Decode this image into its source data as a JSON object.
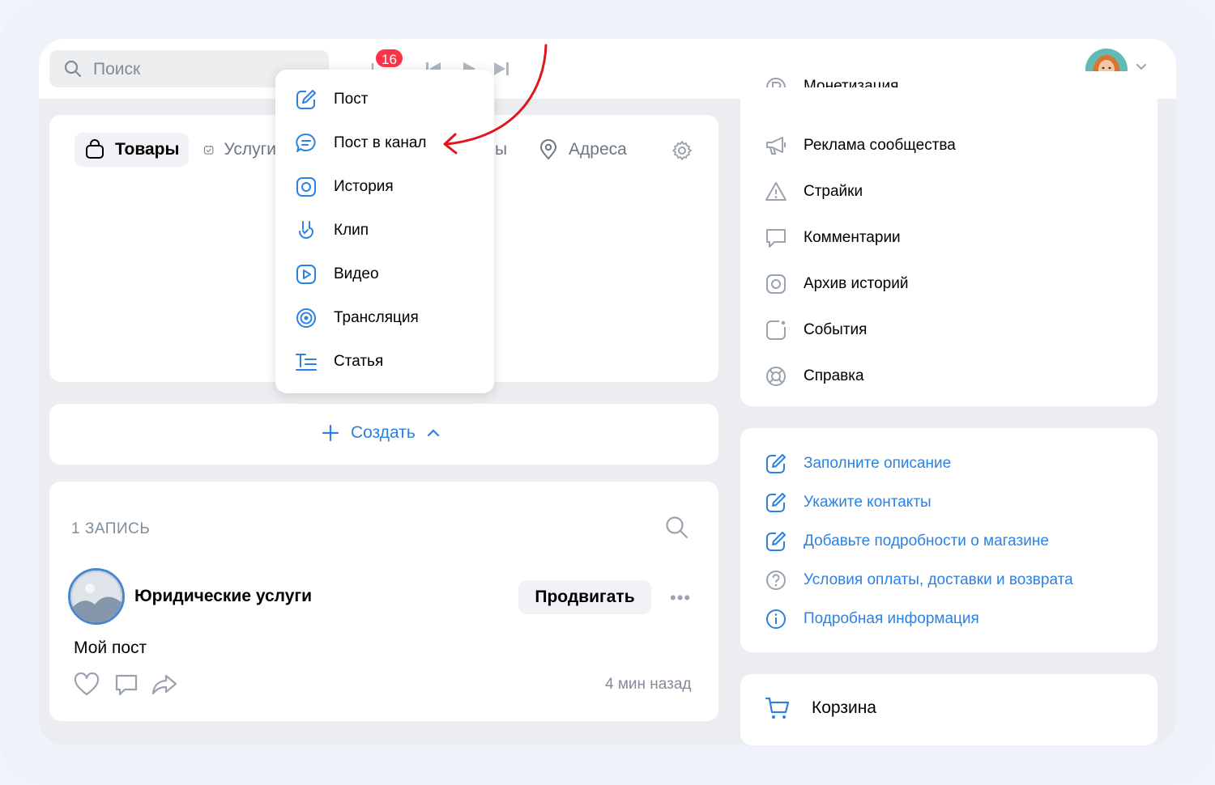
{
  "search": {
    "placeholder": "Поиск"
  },
  "notifications": {
    "badge": "16"
  },
  "tabs": {
    "items": [
      {
        "label": "Товары"
      },
      {
        "label": "Услуги"
      },
      {
        "label": "ы"
      },
      {
        "label": "Адреса"
      }
    ]
  },
  "create": {
    "label": "Создать"
  },
  "dropdown": {
    "items": [
      {
        "label": "Пост",
        "icon": "edit-icon"
      },
      {
        "label": "Пост в канал",
        "icon": "channel-icon"
      },
      {
        "label": "История",
        "icon": "story-icon"
      },
      {
        "label": "Клип",
        "icon": "clip-icon"
      },
      {
        "label": "Видео",
        "icon": "video-icon"
      },
      {
        "label": "Трансляция",
        "icon": "broadcast-icon"
      },
      {
        "label": "Статья",
        "icon": "article-icon"
      }
    ]
  },
  "feed": {
    "count_label": "1 ЗАПИСЬ",
    "post": {
      "author": "Юридические услуги",
      "promote_label": "Продвигать",
      "text": "Мой пост",
      "time": "4 мин назад"
    }
  },
  "menu": {
    "items": [
      {
        "label": "Монетизация",
        "icon": "monetization-icon"
      },
      {
        "label": "Реклама сообщества",
        "icon": "megaphone-icon"
      },
      {
        "label": "Страйки",
        "icon": "warning-icon"
      },
      {
        "label": "Комментарии",
        "icon": "comment-icon"
      },
      {
        "label": "Архив историй",
        "icon": "story-archive-icon"
      },
      {
        "label": "События",
        "icon": "event-icon"
      },
      {
        "label": "Справка",
        "icon": "help-icon"
      }
    ]
  },
  "info": {
    "items": [
      {
        "label": "Заполните описание",
        "icon": "edit-icon"
      },
      {
        "label": "Укажите контакты",
        "icon": "edit-icon"
      },
      {
        "label": "Добавьте подробности о магазине",
        "icon": "edit-icon"
      },
      {
        "label": "Условия оплаты, доставки и возврата",
        "icon": "question-icon"
      },
      {
        "label": "Подробная информация",
        "icon": "info-icon"
      }
    ]
  },
  "cart": {
    "label": "Корзина"
  },
  "colors": {
    "accent": "#2d81e0",
    "badge": "#ff3347",
    "annotation": "#e0161c"
  }
}
